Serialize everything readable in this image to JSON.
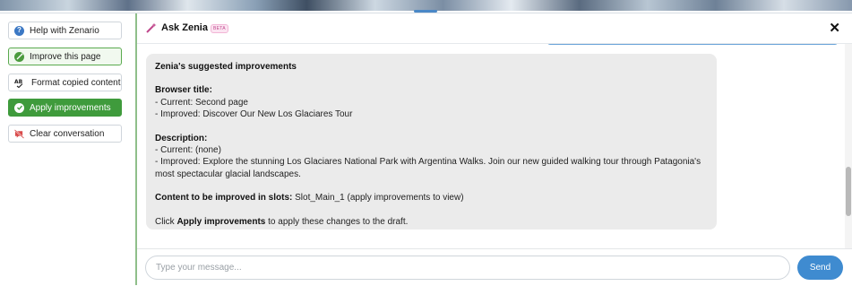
{
  "sidebar": {
    "items": [
      {
        "label": "Help with Zenario",
        "icon": "question-icon"
      },
      {
        "label": "Improve this page",
        "icon": "wand-icon"
      },
      {
        "label": "Format copied content",
        "icon": "spellcheck-icon"
      },
      {
        "label": "Apply improvements",
        "icon": "check-icon"
      },
      {
        "label": "Clear conversation",
        "icon": "clear-icon"
      }
    ]
  },
  "header": {
    "title": "Ask Zenia",
    "badge": "BETA",
    "close_icon": "close-icon"
  },
  "message": {
    "heading": "Zenia's suggested improvements",
    "browser_title_label": "Browser title:",
    "browser_current": "- Current: Second page",
    "browser_improved": "- Improved: Discover Our New Los Glaciares Tour",
    "description_label": "Description:",
    "description_current": "- Current: (none)",
    "description_improved_1": "- Improved: Explore the stunning Los Glaciares National Park with Argentina Walks. Join our new guided walking tour through Patagonia's",
    "description_improved_2": "most spectacular glacial landscapes.",
    "slots_label": "Content to be improved in slots:",
    "slots_value": " Slot_Main_1 (apply improvements to view)",
    "instruction_prefix": "Click ",
    "instruction_bold": "Apply improvements",
    "instruction_suffix": " to apply these changes to the draft."
  },
  "composer": {
    "placeholder": "Type your message...",
    "send_label": "Send"
  },
  "colors": {
    "accent_green": "#3f9b3c",
    "send_blue": "#3f8bd0",
    "bubble_bg": "#ebebeb"
  }
}
